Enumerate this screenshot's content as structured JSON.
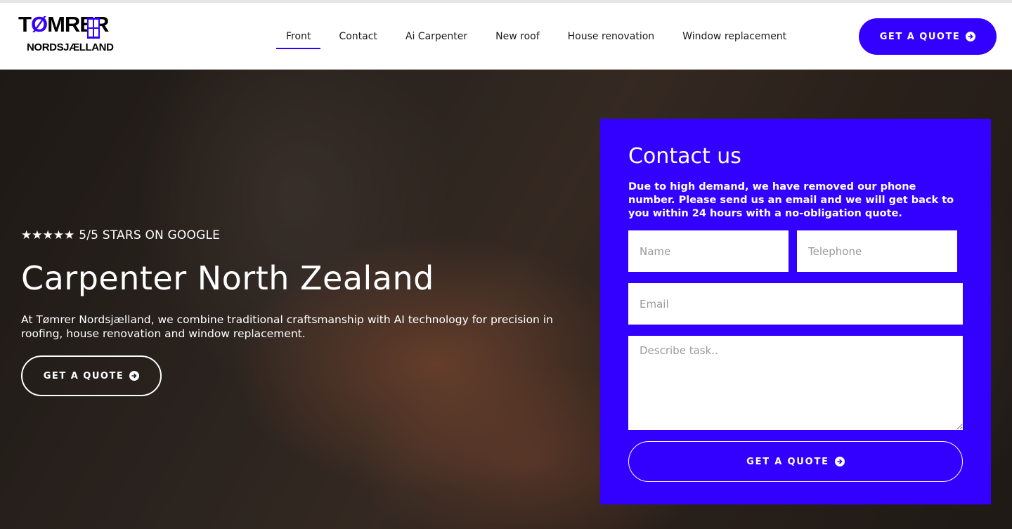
{
  "brand": {
    "logo_top_prefix": "T",
    "logo_top_accent": "Ø",
    "logo_top_rest": "MRER",
    "logo_bottom": "NORDSJÆLLAND",
    "accent_color": "#3300ff"
  },
  "nav": {
    "items": [
      {
        "label": "Front",
        "active": true
      },
      {
        "label": "Contact",
        "active": false
      },
      {
        "label": "Ai Carpenter",
        "active": false
      },
      {
        "label": "New roof",
        "active": false
      },
      {
        "label": "House renovation",
        "active": false
      },
      {
        "label": "Window replacement",
        "active": false
      }
    ],
    "cta_label": "GET A QUOTE",
    "cta_icon": "arrow-circle-right-icon"
  },
  "hero": {
    "stars": "★★★★★",
    "rating_text": "5/5 STARS ON GOOGLE",
    "title": "Carpenter North Zealand",
    "description": "At Tømrer Nordsjælland, we combine traditional craftsmanship with AI technology for precision in roofing, house renovation and window replacement.",
    "cta_label": "GET A QUOTE"
  },
  "contact": {
    "title": "Contact us",
    "note": "Due to high demand, we have removed our phone number. Please send us an email and we will get back to you within 24 hours with a no-obligation quote.",
    "name_placeholder": "Name",
    "phone_placeholder": "Telephone",
    "email_placeholder": "Email",
    "task_placeholder": "Describe task..",
    "submit_label": "GET A QUOTE"
  }
}
